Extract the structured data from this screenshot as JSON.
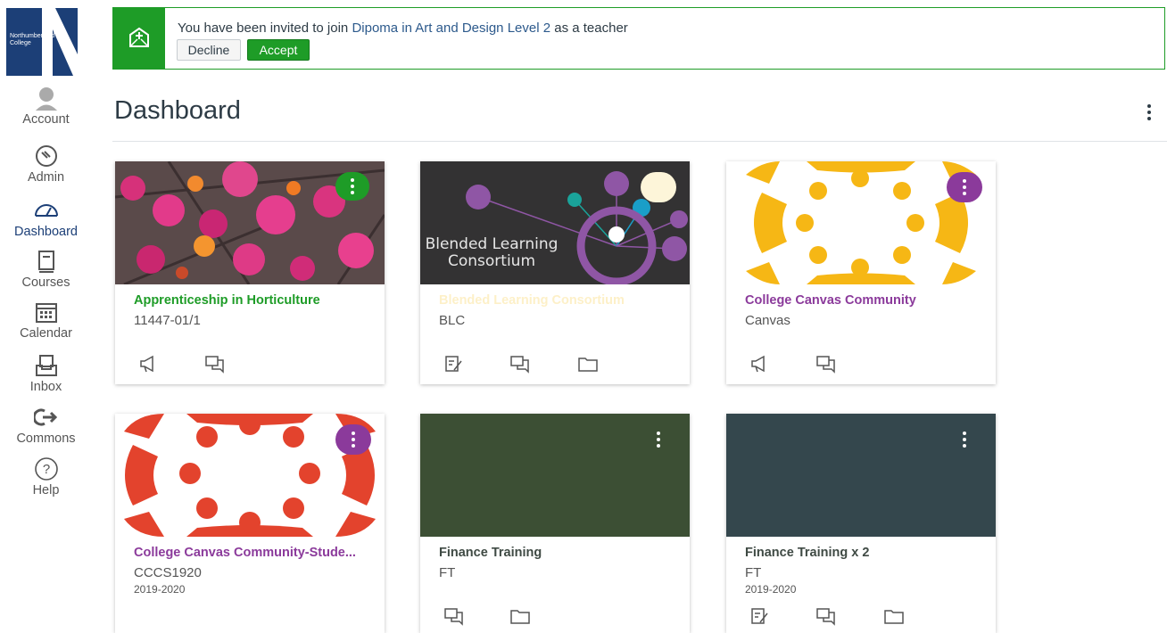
{
  "nav": {
    "logo_text": "Northumberland College",
    "items": [
      {
        "label": "Account",
        "icon": "avatar-icon"
      },
      {
        "label": "Admin",
        "icon": "shield-icon"
      },
      {
        "label": "Dashboard",
        "icon": "speedometer-icon"
      },
      {
        "label": "Courses",
        "icon": "book-icon"
      },
      {
        "label": "Calendar",
        "icon": "calendar-icon"
      },
      {
        "label": "Inbox",
        "icon": "inbox-icon"
      },
      {
        "label": "Commons",
        "icon": "commons-icon"
      },
      {
        "label": "Help",
        "icon": "help-icon"
      }
    ]
  },
  "banner": {
    "msg_before": "You have been invited to join ",
    "course_link": "Dipoma in Art and Design Level 2",
    "msg_after": " as a teacher",
    "decline_label": "Decline",
    "accept_label": "Accept",
    "accent_color": "#1e9c27"
  },
  "header": {
    "title": "Dashboard"
  },
  "cards": [
    {
      "name": "Apprenticeship in Horticulture",
      "code": "11447-01/1",
      "term": "",
      "color": "#1e9c27",
      "icons": [
        "announcement-icon",
        "discussion-icon"
      ]
    },
    {
      "name": "Blended Learning Consortium",
      "code": "BLC",
      "term": "",
      "color": "#fdf5d9",
      "hero_text_line1": "Blended Learning",
      "hero_text_line2": "Consortium",
      "icons": [
        "assignment-icon",
        "discussion-icon",
        "folder-icon"
      ]
    },
    {
      "name": "College Canvas Community",
      "code": "Canvas",
      "term": "",
      "color": "#8b3a9b",
      "icons": [
        "announcement-icon",
        "discussion-icon"
      ]
    },
    {
      "name": "College Canvas Community-Stude...",
      "code": "CCCS1920",
      "term": "2019-2020",
      "color": "#8b3a9b",
      "icons": []
    },
    {
      "name": "Finance Training",
      "code": "FT",
      "term": "",
      "color": "#3c4f34",
      "icons": [
        "discussion-icon",
        "folder-icon"
      ]
    },
    {
      "name": "Finance Training x 2",
      "code": "FT",
      "term": "2019-2020",
      "color": "#34474d",
      "icons": [
        "assignment-icon",
        "discussion-icon",
        "folder-icon"
      ]
    }
  ]
}
